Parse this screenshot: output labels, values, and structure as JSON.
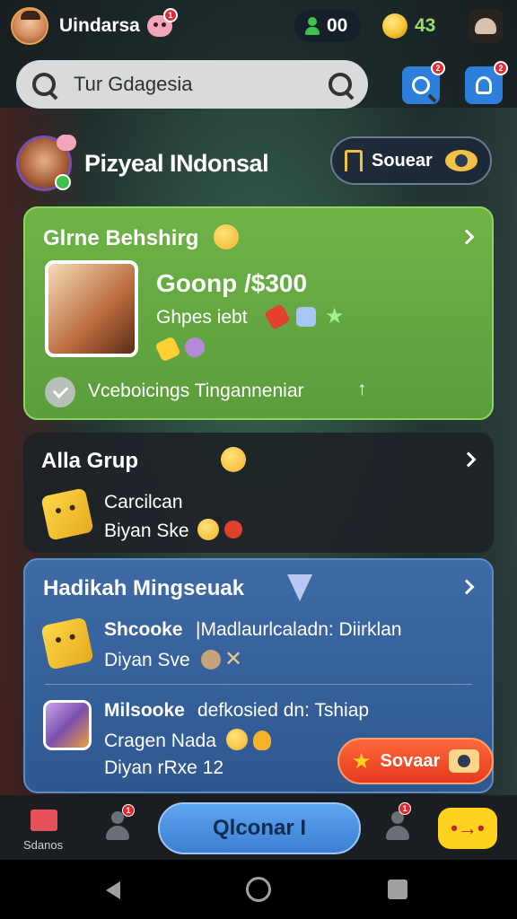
{
  "header": {
    "username": "Uindarsa",
    "mascot_badge": "1",
    "friends_count": "00",
    "coins": "43"
  },
  "search": {
    "value": "Tur Gdagesia",
    "btn1_badge": "2",
    "btn2_badge": "2"
  },
  "club": {
    "title": "Pizyeal INdonsal",
    "action_label": "Souear"
  },
  "card_green": {
    "title": "Glrne Behshirg",
    "prize": "Goonp /$300",
    "subtitle": "Ghpes iebt",
    "footer": "Vceboicings Tinganneniar",
    "footer_arrow": "↑"
  },
  "card_dark": {
    "title": "Alla Grup",
    "line1": "Carcilcan",
    "line2": "Biyan Ske"
  },
  "card_blue": {
    "title": "Hadikah Mingseuak",
    "item1_title_a": "Shcooke",
    "item1_title_b": "|Madlaurlcaladn: Diirklan",
    "item1_sub": "Diyan Sve",
    "item2_title_a": "Milsooke",
    "item2_title_b": "defkosied  dn: Tshiap",
    "item2_line2": "Cragen Nada",
    "item2_line3": "Diyan rRxe  12",
    "cta_label": "Sovaar"
  },
  "bottom_nav": {
    "home_label": "Sdanos",
    "main_label": "Qlconar I",
    "badge_a": "1",
    "badge_b": "1"
  },
  "colors": {
    "green_card": "#62a540",
    "blue_card": "#3a649f",
    "dark_card": "#1e2228",
    "accent_orange": "#e94a24",
    "accent_yellow": "#ffd21f",
    "nav_blue": "#4a90e2"
  }
}
